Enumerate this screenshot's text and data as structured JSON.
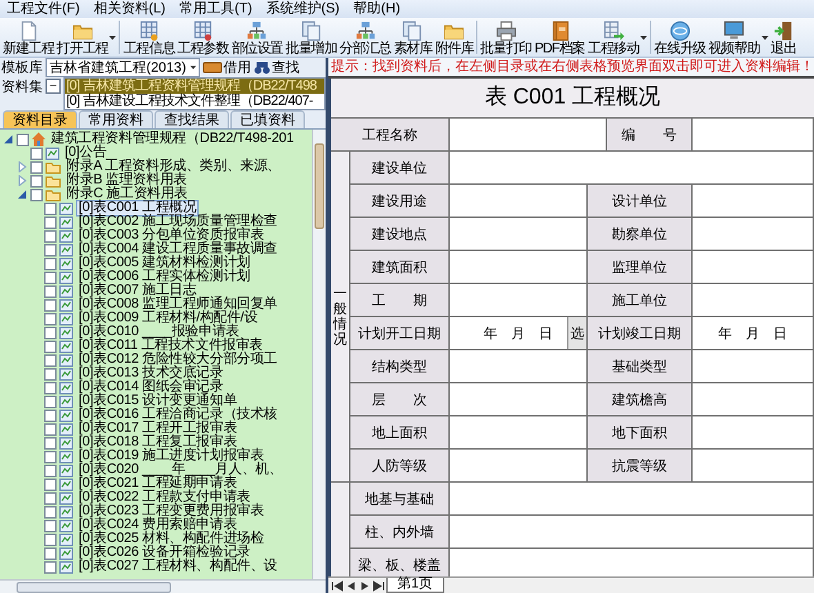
{
  "menu": [
    {
      "label": "工程文件(F)"
    },
    {
      "label": "相关资料(L)"
    },
    {
      "label": "常用工具(T)"
    },
    {
      "label": "系统维护(S)"
    },
    {
      "label": "帮助(H)"
    }
  ],
  "toolbar": [
    {
      "label": "新建工程",
      "dropdown": false
    },
    {
      "label": "打开工程",
      "dropdown": true
    },
    {
      "label": "工程信息",
      "dropdown": false
    },
    {
      "label": "工程参数",
      "dropdown": false
    },
    {
      "label": "部位设置",
      "dropdown": false
    },
    {
      "label": "批量增加",
      "dropdown": false
    },
    {
      "label": "分部汇总",
      "dropdown": false
    },
    {
      "label": "素材库",
      "dropdown": false
    },
    {
      "label": "附件库",
      "dropdown": false
    },
    {
      "label": "批量打印",
      "dropdown": false
    },
    {
      "label": "PDF档案",
      "dropdown": false
    },
    {
      "label": "工程移动",
      "dropdown": true
    },
    {
      "label": "在线升级",
      "dropdown": false
    },
    {
      "label": "视频帮助",
      "dropdown": true
    },
    {
      "label": "退出",
      "dropdown": false
    }
  ],
  "template": {
    "label": "模板库",
    "value": "吉林省建筑工程(2013)",
    "borrow": "借用",
    "find": "查找"
  },
  "dataset": {
    "label": "资料集",
    "toggle": "−",
    "items": [
      {
        "text": "[0] 吉林建筑工程资料管理规程（DB22/T498",
        "selected": true
      },
      {
        "text": "[0] 吉林建设工程技术文件整理（DB22/407-",
        "selected": false
      }
    ]
  },
  "tabs": [
    {
      "label": "资料目录",
      "selected": true
    },
    {
      "label": "常用资料",
      "selected": false
    },
    {
      "label": "查找结果",
      "selected": false
    },
    {
      "label": "已填资料",
      "selected": false
    }
  ],
  "tree": [
    {
      "kind": "root",
      "text": "建筑工程资料管理规程（DB22/T498-201",
      "expanded": true,
      "checked": false,
      "selected": false,
      "children": [
        {
          "kind": "sheet",
          "text": "[0]公告",
          "checked": false,
          "selected": false
        },
        {
          "kind": "folder",
          "text": "附录A 工程资料形成、类别、来源、",
          "expanded": false,
          "checked": false,
          "selected": false
        },
        {
          "kind": "folder",
          "text": "附录B 监理资料用表",
          "expanded": false,
          "checked": false,
          "selected": false
        },
        {
          "kind": "folder",
          "text": "附录C 施工资料用表",
          "expanded": true,
          "checked": false,
          "selected": false,
          "children": [
            {
              "kind": "sheet",
              "text": "[0]表C001 工程概况",
              "checked": false,
              "selected": true
            },
            {
              "kind": "sheet",
              "text": "[0]表C002 施工现场质量管理检查",
              "checked": false,
              "selected": false
            },
            {
              "kind": "sheet",
              "text": "[0]表C003 分包单位资质报审表",
              "checked": false,
              "selected": false
            },
            {
              "kind": "sheet",
              "text": "[0]表C004 建设工程质量事故调查",
              "checked": false,
              "selected": false
            },
            {
              "kind": "sheet",
              "text": "[0]表C005 建筑材料检测计划",
              "checked": false,
              "selected": false
            },
            {
              "kind": "sheet",
              "text": "[0]表C006 工程实体检测计划",
              "checked": false,
              "selected": false
            },
            {
              "kind": "sheet",
              "text": "[0]表C007 施工日志",
              "checked": false,
              "selected": false
            },
            {
              "kind": "sheet",
              "text": "[0]表C008 监理工程师通知回复单",
              "checked": false,
              "selected": false
            },
            {
              "kind": "sheet",
              "text": "[0]表C009 工程材料/构配件/设",
              "checked": false,
              "selected": false
            },
            {
              "kind": "sheet",
              "text": "[0]表C010 ____报验申请表",
              "checked": false,
              "selected": false
            },
            {
              "kind": "sheet",
              "text": "[0]表C011 工程技术文件报审表",
              "checked": false,
              "selected": false
            },
            {
              "kind": "sheet",
              "text": "[0]表C012 危险性较大分部分项工",
              "checked": false,
              "selected": false
            },
            {
              "kind": "sheet",
              "text": "[0]表C013 技术交底记录",
              "checked": false,
              "selected": false
            },
            {
              "kind": "sheet",
              "text": "[0]表C014 图纸会审记录",
              "checked": false,
              "selected": false
            },
            {
              "kind": "sheet",
              "text": "[0]表C015 设计变更通知单",
              "checked": false,
              "selected": false
            },
            {
              "kind": "sheet",
              "text": "[0]表C016 工程洽商记录（技术核",
              "checked": false,
              "selected": false
            },
            {
              "kind": "sheet",
              "text": "[0]表C017 工程开工报审表",
              "checked": false,
              "selected": false
            },
            {
              "kind": "sheet",
              "text": "[0]表C018 工程复工报审表",
              "checked": false,
              "selected": false
            },
            {
              "kind": "sheet",
              "text": "[0]表C019 施工进度计划报审表",
              "checked": false,
              "selected": false
            },
            {
              "kind": "sheet",
              "text": "[0]表C020 ____年____月人、机、",
              "checked": false,
              "selected": false
            },
            {
              "kind": "sheet",
              "text": "[0]表C021 工程延期申请表",
              "checked": false,
              "selected": false
            },
            {
              "kind": "sheet",
              "text": "[0]表C022 工程款支付申请表",
              "checked": false,
              "selected": false
            },
            {
              "kind": "sheet",
              "text": "[0]表C023 工程变更费用报审表",
              "checked": false,
              "selected": false
            },
            {
              "kind": "sheet",
              "text": "[0]表C024 费用索赔申请表",
              "checked": false,
              "selected": false
            },
            {
              "kind": "sheet",
              "text": "[0]表C025 材料、构配件进场检",
              "checked": false,
              "selected": false
            },
            {
              "kind": "sheet",
              "text": "[0]表C026 设备开箱检验记录",
              "checked": false,
              "selected": false
            },
            {
              "kind": "sheet",
              "text": "[0]表C027 工程材料、构配件、设",
              "checked": false,
              "selected": false
            }
          ]
        }
      ]
    }
  ],
  "hint": "提示：找到资料后，在左侧目录或在右侧表格预览界面双击即可进入资料编辑！",
  "form": {
    "title": "表 C001 工程概况",
    "header": {
      "label": "工程名称",
      "label2": "编　　号"
    },
    "groups": [
      {
        "label": "一般情况",
        "rows": [
          {
            "kind": "wide",
            "label": "建设单位"
          },
          {
            "kind": "pair",
            "label": "建设用途",
            "label2": "设计单位"
          },
          {
            "kind": "pair",
            "label": "建设地点",
            "label2": "勘察单位"
          },
          {
            "kind": "pair",
            "label": "建筑面积",
            "label2": "监理单位"
          },
          {
            "kind": "pair",
            "label": "工　　期",
            "label2": "施工单位"
          },
          {
            "kind": "pair",
            "label": "计划开工日期",
            "value": "年　月　日",
            "button": "选",
            "label2": "计划竣工日期",
            "value2": "年　月　日"
          },
          {
            "kind": "pair",
            "label": "结构类型",
            "label2": "基础类型"
          },
          {
            "kind": "pair",
            "label": "层　　次",
            "label2": "建筑檐高"
          },
          {
            "kind": "pair",
            "label": "地上面积",
            "label2": "地下面积"
          },
          {
            "kind": "pair",
            "label": "人防等级",
            "label2": "抗震等级"
          }
        ]
      },
      {
        "rows": [
          {
            "kind": "wide",
            "label": "地基与基础"
          },
          {
            "kind": "wide",
            "label": "柱、内外墙"
          },
          {
            "kind": "wide",
            "label": "梁、板、楼盖"
          }
        ]
      }
    ]
  },
  "sheet_tabs": [
    {
      "label": "第1页",
      "selected": true
    }
  ]
}
